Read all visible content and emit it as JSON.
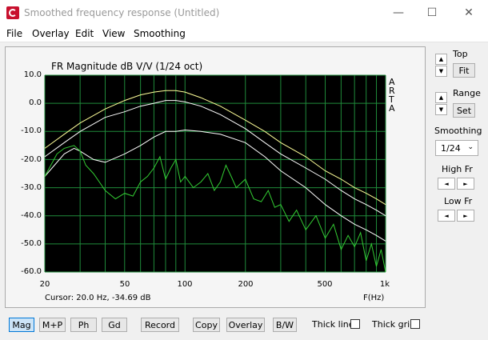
{
  "window": {
    "title": "Smoothed frequency response (Untitled)",
    "minimize": "—",
    "maximize": "☐",
    "close": "✕"
  },
  "menu": [
    "File",
    "Overlay",
    "Edit",
    "View",
    "Smoothing"
  ],
  "plot": {
    "title": "FR Magnitude dB V/V (1/24 oct)",
    "side_letters": [
      "A",
      "R",
      "T",
      "A"
    ],
    "y_ticks": [
      "10.0",
      "0.0",
      "-10.0",
      "-20.0",
      "-30.0",
      "-40.0",
      "-50.0",
      "-60.0"
    ],
    "x_ticks": [
      "20",
      "50",
      "100",
      "200",
      "500",
      "1k"
    ],
    "x_unit": "F(Hz)",
    "cursor": "Cursor: 20.0 Hz, -34.69 dB"
  },
  "chart_data": {
    "type": "line",
    "xscale": "log",
    "xlim": [
      20,
      1000
    ],
    "ylim": [
      -60,
      10
    ],
    "grid": true,
    "background": "#000000",
    "series": [
      {
        "color": "#ffff99",
        "x": [
          20,
          25,
          30,
          40,
          50,
          60,
          70,
          80,
          90,
          100,
          120,
          150,
          200,
          250,
          300,
          400,
          500,
          600,
          700,
          800,
          900,
          1000
        ],
        "y": [
          -16,
          -11,
          -7,
          -2,
          1,
          3,
          4,
          4.5,
          4.5,
          4,
          2,
          -1,
          -6,
          -10,
          -14,
          -19,
          -24,
          -27,
          -30,
          -32,
          -34,
          -36
        ]
      },
      {
        "color": "#ffffff",
        "x": [
          20,
          25,
          30,
          40,
          50,
          60,
          70,
          80,
          90,
          100,
          120,
          150,
          200,
          250,
          300,
          400,
          500,
          600,
          700,
          800,
          900,
          1000
        ],
        "y": [
          -19,
          -14,
          -10,
          -5,
          -3,
          -1,
          0,
          1,
          1,
          0.5,
          -1,
          -4,
          -9,
          -14,
          -18,
          -23,
          -27,
          -31,
          -34,
          -36,
          -38,
          -40
        ]
      },
      {
        "color": "#ffffff",
        "x": [
          20,
          25,
          28,
          30,
          35,
          40,
          50,
          60,
          70,
          80,
          90,
          100,
          120,
          150,
          200,
          250,
          300,
          400,
          500,
          600,
          700,
          800,
          900,
          1000
        ],
        "y": [
          -26,
          -18,
          -16,
          -17,
          -20,
          -21,
          -18,
          -15,
          -12,
          -10,
          -10,
          -9.5,
          -10,
          -11,
          -14,
          -19,
          -24,
          -30,
          -36,
          -40,
          -43,
          -45,
          -47,
          -49
        ]
      },
      {
        "color": "#33cc33",
        "x": [
          20,
          23,
          25,
          28,
          30,
          32,
          35,
          40,
          45,
          50,
          55,
          60,
          65,
          70,
          75,
          80,
          85,
          90,
          95,
          100,
          110,
          120,
          130,
          140,
          150,
          160,
          170,
          180,
          200,
          220,
          240,
          260,
          280,
          300,
          330,
          360,
          400,
          450,
          500,
          550,
          600,
          650,
          700,
          750,
          800,
          850,
          900,
          950,
          1000
        ],
        "y": [
          -26,
          -18,
          -16,
          -15,
          -17,
          -22,
          -25,
          -31,
          -34,
          -32,
          -33,
          -28,
          -26,
          -23,
          -19,
          -27,
          -23,
          -20,
          -28,
          -26,
          -30,
          -28,
          -25,
          -31,
          -28,
          -22,
          -26,
          -30,
          -27,
          -34,
          -35,
          -31,
          -37,
          -36,
          -42,
          -38,
          -45,
          -40,
          -48,
          -43,
          -52,
          -47,
          -51,
          -46,
          -56,
          -50,
          -58,
          -52,
          -60
        ]
      }
    ]
  },
  "toolbar": {
    "mag": "Mag",
    "mp": "M+P",
    "ph": "Ph",
    "gd": "Gd",
    "record": "Record",
    "copy": "Copy",
    "overlay": "Overlay",
    "bw": "B/W",
    "thick_line": "Thick line",
    "thick_grid": "Thick grid"
  },
  "side": {
    "top": "Top",
    "fit": "Fit",
    "range": "Range",
    "set": "Set",
    "smoothing": "Smoothing",
    "smoothing_value": "1/24",
    "high_fr": "High Fr",
    "low_fr": "Low Fr"
  },
  "glyphs": {
    "up": "▲",
    "down": "▼",
    "left": "◄",
    "right": "►",
    "dropdown": "⌄"
  }
}
